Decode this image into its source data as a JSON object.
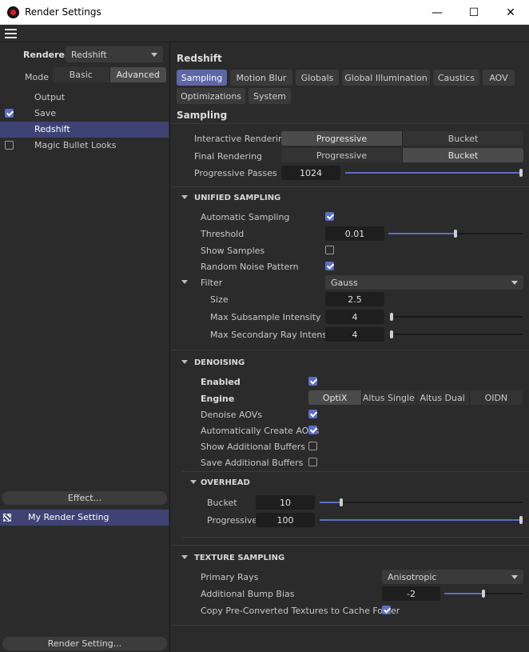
{
  "window": {
    "title": "Render Settings",
    "minimize": "—",
    "maximize": "☐",
    "close": "✕"
  },
  "left": {
    "renderer_label": "Renderer",
    "renderer_value": "Redshift",
    "mode_label": "Mode",
    "mode_options": [
      "Basic",
      "Advanced"
    ],
    "mode_selected": "Advanced",
    "items": [
      {
        "label": "Output",
        "checked": false,
        "has_check": false
      },
      {
        "label": "Save",
        "checked": true,
        "has_check": true
      },
      {
        "label": "Redshift",
        "checked": false,
        "has_check": false,
        "selected": true
      },
      {
        "label": "Magic Bullet Looks",
        "checked": false,
        "has_check": true
      }
    ],
    "effect_button": "Effect...",
    "render_setting_item": "My Render Setting",
    "render_setting_button": "Render Setting..."
  },
  "right": {
    "header": "Redshift",
    "tabs_row1": [
      "Sampling",
      "Motion Blur",
      "Globals",
      "Global Illumination",
      "Caustics",
      "AOV"
    ],
    "tabs_row2": [
      "Optimizations",
      "System"
    ],
    "active_tab": "Sampling",
    "section_title": "Sampling",
    "interactive_rendering": {
      "label": "Interactive Rendering",
      "options": [
        "Progressive",
        "Bucket"
      ],
      "selected": "Progressive"
    },
    "final_rendering": {
      "label": "Final Rendering",
      "options": [
        "Progressive",
        "Bucket"
      ],
      "selected": "Bucket"
    },
    "progressive_passes": {
      "label": "Progressive Passes",
      "value": "1024",
      "fraction": 1.0
    },
    "unified": {
      "title": "UNIFIED SAMPLING",
      "automatic_sampling": {
        "label": "Automatic Sampling",
        "checked": true
      },
      "threshold": {
        "label": "Threshold",
        "value": "0.01",
        "fraction": 0.5
      },
      "show_samples": {
        "label": "Show Samples",
        "checked": false
      },
      "random_noise": {
        "label": "Random Noise Pattern",
        "checked": true
      },
      "filter": {
        "label": "Filter",
        "value": "Gauss"
      },
      "size": {
        "label": "Size",
        "value": "2.5"
      },
      "max_subsample": {
        "label": "Max Subsample Intensity",
        "value": "4",
        "fraction": 0.0
      },
      "max_secondary": {
        "label": "Max Secondary Ray Intensity",
        "value": "4",
        "fraction": 0.0
      }
    },
    "denoising": {
      "title": "DENOISING",
      "enabled": {
        "label": "Enabled",
        "checked": true
      },
      "engine": {
        "label": "Engine",
        "options": [
          "OptiX",
          "Altus Single",
          "Altus Dual",
          "OIDN"
        ],
        "selected": "OptiX"
      },
      "denoise_aovs": {
        "label": "Denoise AOVs",
        "checked": true
      },
      "auto_create": {
        "label": "Automatically Create AOVs",
        "checked": true
      },
      "show_buffers": {
        "label": "Show Additional Buffers",
        "checked": false
      },
      "save_buffers": {
        "label": "Save Additional Buffers",
        "checked": false
      },
      "overhead": {
        "title": "OVERHEAD",
        "bucket": {
          "label": "Bucket",
          "value": "10",
          "fraction": 0.1
        },
        "progressive": {
          "label": "Progressive",
          "value": "100",
          "fraction": 1.0
        }
      }
    },
    "texture": {
      "title": "TEXTURE SAMPLING",
      "primary_rays": {
        "label": "Primary Rays",
        "value": "Anisotropic"
      },
      "bump_bias": {
        "label": "Additional Bump Bias",
        "value": "-2",
        "fraction": 0.5
      },
      "copy_textures": {
        "label": "Copy Pre-Converted Textures to Cache Folder",
        "checked": true
      }
    }
  },
  "colors": {
    "accent": "#5c6ec8",
    "tab_active": "#5d67a6",
    "selection": "#3e4373"
  }
}
